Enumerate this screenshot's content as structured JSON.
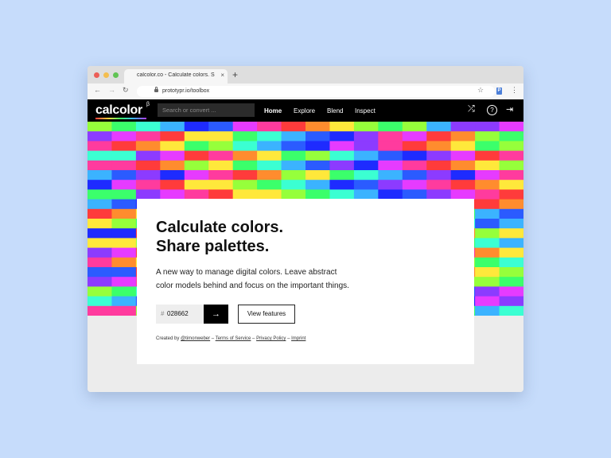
{
  "browser": {
    "tab_title": "calcolor.co - Calculate colors. Share",
    "tab_close": "×",
    "new_tab": "+",
    "url": "prototypr.io/toolbox",
    "back": "←",
    "forward": "→",
    "reload": "↻",
    "star": "☆",
    "extension": "P",
    "menu": "⋮"
  },
  "app": {
    "logo": "calcolor",
    "logo_sup": "β",
    "search_placeholder": "Search or convert ...",
    "nav": [
      "Home",
      "Explore",
      "Blend",
      "Inspect"
    ],
    "icons": {
      "shuffle": "⤮",
      "help": "?",
      "login": "⇥"
    }
  },
  "hero": {
    "headline_line1": "Calculate colors.",
    "headline_line2": "Share palettes.",
    "desc_line1": "A new way to manage digital colors. Leave abstract",
    "desc_line2": "color models behind and focus on the important things.",
    "hex_symbol": "#",
    "hex_value": "028662",
    "go_arrow": "→",
    "features_button": "View features"
  },
  "credits": {
    "prefix": "Created by ",
    "author": "@timonweber",
    "sep": " – ",
    "terms": "Terms of Service",
    "privacy": "Privacy Policy",
    "imprint": "Imprint"
  },
  "palette": [
    "#ff3b3b",
    "#ff8c2e",
    "#ffe83b",
    "#96ff3b",
    "#3bff6b",
    "#3bffd2",
    "#3bb3ff",
    "#2b5bff",
    "#1e2bff",
    "#8c3bff",
    "#e63bff",
    "#ff3b9e"
  ],
  "mosaic_rows": [
    [
      3,
      4,
      5,
      6,
      8,
      7,
      10,
      11,
      0,
      1,
      2,
      3,
      4,
      3,
      6,
      9,
      9,
      10
    ],
    [
      9,
      10,
      11,
      0,
      2,
      2,
      4,
      5,
      6,
      7,
      8,
      9,
      11,
      10,
      0,
      1,
      3,
      4
    ],
    [
      11,
      0,
      1,
      2,
      4,
      3,
      5,
      6,
      7,
      8,
      10,
      9,
      11,
      0,
      1,
      2,
      4,
      3
    ],
    [
      5,
      5,
      9,
      10,
      0,
      11,
      1,
      2,
      4,
      3,
      5,
      6,
      7,
      8,
      9,
      10,
      0,
      11
    ],
    [
      11,
      11,
      0,
      1,
      3,
      2,
      4,
      5,
      6,
      7,
      9,
      8,
      10,
      11,
      0,
      1,
      2,
      3
    ],
    [
      6,
      7,
      9,
      8,
      10,
      11,
      0,
      1,
      3,
      2,
      4,
      5,
      6,
      7,
      9,
      8,
      10,
      11
    ],
    [
      8,
      10,
      11,
      0,
      2,
      2,
      3,
      4,
      5,
      6,
      8,
      7,
      9,
      10,
      11,
      0,
      1,
      2
    ],
    [
      4,
      4,
      9,
      10,
      11,
      0,
      2,
      2,
      3,
      4,
      5,
      6,
      8,
      7,
      9,
      10,
      11,
      0
    ]
  ]
}
